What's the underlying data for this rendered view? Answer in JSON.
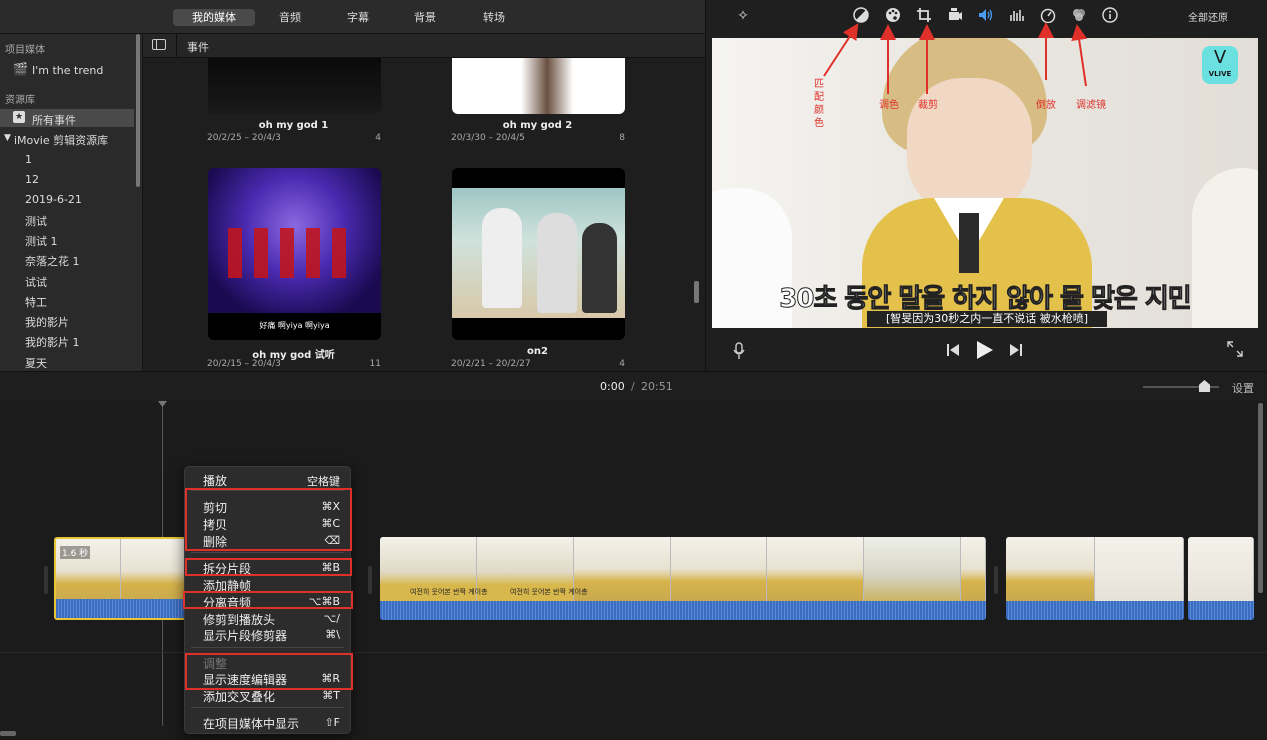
{
  "tabs": [
    "我的媒体",
    "音频",
    "字幕",
    "背景",
    "转场"
  ],
  "sidebar": {
    "project_media_header": "项目媒体",
    "project_name": "I'm the trend",
    "library_header": "资源库",
    "all_events": "所有事件",
    "library_name": "iMovie 剪辑资源库",
    "events": [
      "1",
      "12",
      "2019-6-21",
      "测试",
      "测试 1",
      "奈落之花 1",
      "试试",
      "特工",
      "我的影片",
      "我的影片 1",
      "夏天"
    ]
  },
  "browser": {
    "header": "事件",
    "items": [
      {
        "title": "oh my god 1",
        "date": "20/2/25 – 20/4/3",
        "count": "4"
      },
      {
        "title": "oh my god 2",
        "date": "20/3/30 – 20/4/5",
        "count": "8"
      },
      {
        "title": "oh my god 试听",
        "date": "20/2/15 – 20/4/3",
        "count": "11",
        "caption": "好痛 啊yiya 啊yiya"
      },
      {
        "title": "on2",
        "date": "20/2/21 – 20/2/27",
        "count": "4"
      }
    ]
  },
  "viewer": {
    "reset_all": "全部还原",
    "subtitle_main": "30초 동안 말을 하지 않아 물 맞은 지민",
    "subtitle_cn": "[智旻因为30秒之内一直不说话 被水枪喷]",
    "logo": "VLIVE",
    "annotations": {
      "match_color": "匹配颜色",
      "color": "调色",
      "crop": "裁剪",
      "reverse": "倒放",
      "filter": "调滤镜"
    }
  },
  "timecode": {
    "current": "0:00",
    "separator": "/",
    "total": "20:51"
  },
  "settings_label": "设置",
  "clip_duration": "1.6 秒",
  "clip_captions": [
    "여전히 웃어본 반짝 계이총",
    "여전히 웃어본 반짝 계이총"
  ],
  "context_menu": {
    "items": [
      {
        "label": "播放",
        "key": "空格键"
      },
      {
        "label": "剪切",
        "key": "⌘X"
      },
      {
        "label": "拷贝",
        "key": "⌘C"
      },
      {
        "label": "删除",
        "key": "⌫"
      },
      {
        "label": "拆分片段",
        "key": "⌘B"
      },
      {
        "label": "添加静帧",
        "key": ""
      },
      {
        "label": "分离音频",
        "key": "⌥⌘B"
      },
      {
        "label": "修剪到播放头",
        "key": "⌥/"
      },
      {
        "label": "显示片段修剪器",
        "key": "⌘\\"
      },
      {
        "label": "调整",
        "key": ""
      },
      {
        "label": "显示速度编辑器",
        "key": "⌘R"
      },
      {
        "label": "添加交叉叠化",
        "key": "⌘T"
      },
      {
        "label": "在项目媒体中显示",
        "key": "⇧F"
      }
    ]
  },
  "colors": {
    "accent_red": "#e0302a",
    "waveform": "#2a5ba8",
    "selected_clip_border": "#e8c536"
  }
}
